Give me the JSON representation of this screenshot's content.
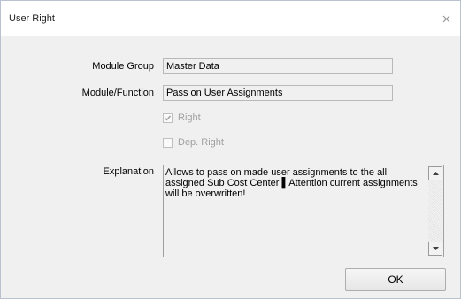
{
  "window": {
    "title": "User Right"
  },
  "form": {
    "module_group_label": "Module Group",
    "module_group_value": "Master Data",
    "module_function_label": "Module/Function",
    "module_function_value": "Pass on User Assignments",
    "right_label": "Right",
    "right_checked": true,
    "dep_right_label": "Dep. Right",
    "dep_right_checked": false,
    "explanation_label": "Explanation",
    "explanation_text": "Allows to pass on made user assignments to the all assigned Sub Cost Center ▌Attention current assignments will be overwritten!"
  },
  "buttons": {
    "ok_label": "OK"
  },
  "icons": {
    "close": "close-icon",
    "scroll_up": "arrow-up-icon",
    "scroll_down": "arrow-down-icon",
    "check": "checkmark-icon"
  }
}
